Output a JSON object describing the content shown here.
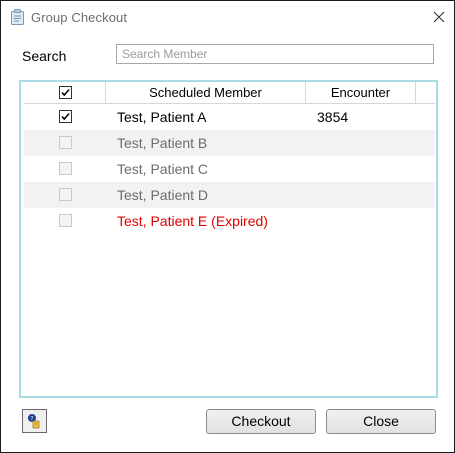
{
  "window": {
    "title": "Group Checkout"
  },
  "search": {
    "label": "Search",
    "placeholder": "Search Member",
    "value": ""
  },
  "grid": {
    "columns": [
      "Scheduled Member",
      "Encounter"
    ],
    "select_all_checked": true,
    "rows": [
      {
        "name": "Test, Patient A",
        "encounter": "3854",
        "checked": true,
        "enabled": true,
        "status": "normal"
      },
      {
        "name": "Test, Patient B",
        "encounter": "",
        "checked": false,
        "enabled": false,
        "status": "disabled"
      },
      {
        "name": "Test, Patient C",
        "encounter": "",
        "checked": false,
        "enabled": false,
        "status": "disabled"
      },
      {
        "name": "Test, Patient D",
        "encounter": "",
        "checked": false,
        "enabled": false,
        "status": "disabled"
      },
      {
        "name": "Test, Patient E  (Expired)",
        "encounter": "",
        "checked": false,
        "enabled": false,
        "status": "expired"
      }
    ]
  },
  "footer": {
    "checkout_label": "Checkout",
    "close_label": "Close"
  },
  "colors": {
    "expired": "#e00000",
    "disabled_text": "#6d6d6d",
    "grid_border": "#a9dce4",
    "row_alt": "#f2f2f2"
  },
  "icons": {
    "app": "clipboard-icon",
    "close": "close-icon",
    "help": "help-icon"
  }
}
